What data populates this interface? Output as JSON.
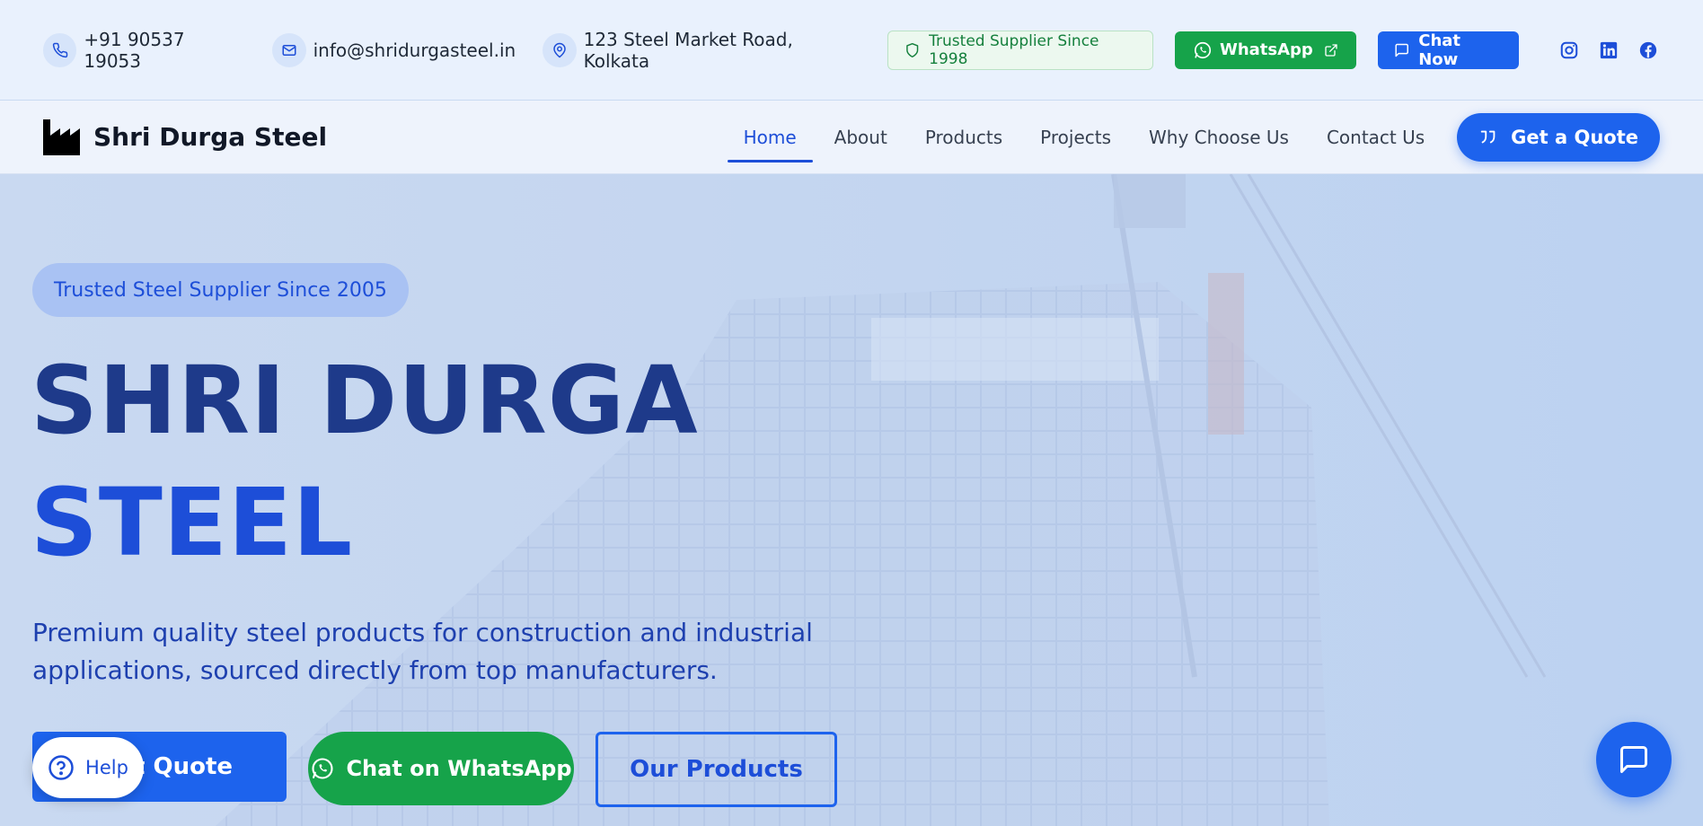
{
  "topbar": {
    "phone": "+91 90537 19053",
    "email": "info@shridurgasteel.in",
    "address": "123 Steel Market Road, Kolkata",
    "trust_pill": "Trusted Supplier Since 1998",
    "whatsapp_label": "WhatsApp",
    "chat_label": "Chat Now",
    "social": [
      "instagram-icon",
      "linkedin-icon",
      "facebook-icon"
    ]
  },
  "navbar": {
    "brand": "Shri Durga Steel",
    "items": [
      {
        "label": "Home",
        "active": true
      },
      {
        "label": "About",
        "active": false
      },
      {
        "label": "Products",
        "active": false
      },
      {
        "label": "Projects",
        "active": false
      },
      {
        "label": "Why Choose Us",
        "active": false
      },
      {
        "label": "Contact Us",
        "active": false
      }
    ],
    "quote_label": "Get a Quote"
  },
  "hero": {
    "badge": "Trusted Steel Supplier Since 2005",
    "title_line1": "SHRI DURGA",
    "title_line2": "STEEL",
    "subtitle": "Premium quality steel products for construction and industrial applications, sourced directly from top manufacturers.",
    "request_quote_visible": "est Quote",
    "whatsapp_cta": "Chat on WhatsApp",
    "products_cta": "Our Products",
    "help_label": "Help"
  },
  "colors": {
    "brand_blue": "#1d63ed",
    "dark_blue": "#1e3a8a",
    "whatsapp_green": "#16a34a"
  }
}
